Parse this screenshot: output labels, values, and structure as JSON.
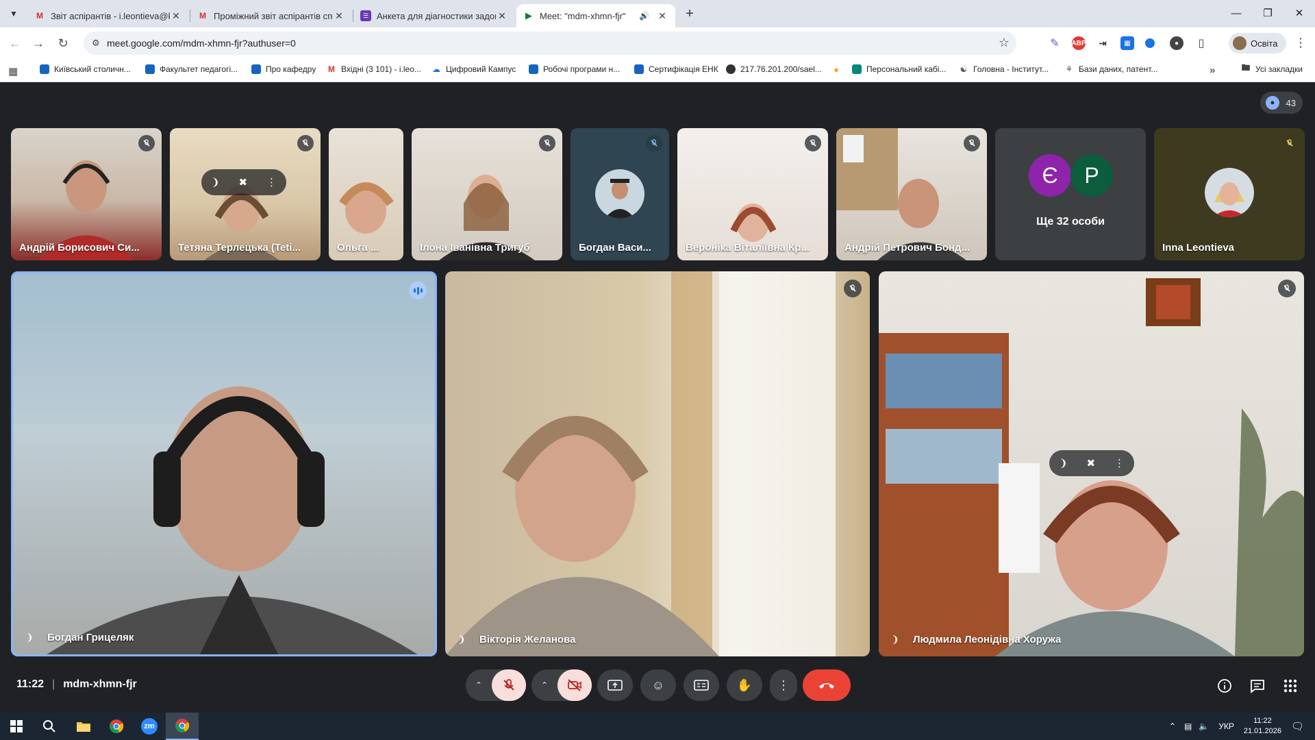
{
  "browser": {
    "tabs": [
      {
        "title": "Звіт аспірантів - i.leontieva@ku",
        "icon": "gmail-icon",
        "active": false,
        "audio": false
      },
      {
        "title": "Проміжний звіт аспірантів спе",
        "icon": "gmail-icon",
        "active": false,
        "audio": false
      },
      {
        "title": "Анкета для діагностики задово",
        "icon": "google-forms-icon",
        "active": false,
        "audio": false
      },
      {
        "title": "Meet: \"mdm-xhmn-fjr\"",
        "icon": "google-meet-icon",
        "active": true,
        "audio": true
      }
    ],
    "url": "meet.google.com/mdm-xhmn-fjr?authuser=0",
    "profile_name": "Освіта",
    "bookmarks": [
      "Київський столичн...",
      "Факультет педагогі...",
      "Про кафедру",
      "Вхідні (3 101) - i.leo...",
      "Цифровий Кампус",
      "Робочі програми н...",
      "Сертифікація ЕНК",
      "217.76.201.200/sael...",
      "",
      "Персональний кабі...",
      "Головна - Інститут...",
      "Бази даних, патент..."
    ],
    "all_bookmarks_label": "Усі закладки",
    "extensions_abp_label": "ABP"
  },
  "meet": {
    "participant_count": "43",
    "more_people_label": "Ще 32 особи",
    "more_people_initials": [
      "Є",
      "Р"
    ],
    "filmstrip": [
      {
        "name": "Андрій Борисович Си...",
        "muted": true
      },
      {
        "name": "Тетяна Терлецька (Teti...",
        "muted": true
      },
      {
        "name": "Ольга ...",
        "muted": false
      },
      {
        "name": "Ілона Іванівна Тригуб",
        "muted": true
      },
      {
        "name": "Богдан Васи...",
        "muted": true
      },
      {
        "name": "Вероніка Віталіївна Кр...",
        "muted": true
      },
      {
        "name": "Андрій Петрович Бонд...",
        "muted": true
      },
      {
        "name": "Inna Leontieva",
        "muted": true
      }
    ],
    "main": [
      {
        "name": "Богдан Грицеляк",
        "speaking": true
      },
      {
        "name": "Вікторія Желанова",
        "speaking": false
      },
      {
        "name": "Людмила Леонідівна Хоружа",
        "speaking": false
      }
    ],
    "time": "11:22",
    "meeting_code": "mdm-xhmn-fjr"
  },
  "taskbar": {
    "language": "УКР",
    "time": "11:22",
    "date": "21.01.2026",
    "zoom_label": "zm"
  },
  "colors": {
    "meet_bg": "#202124",
    "tile_bg": "#3c4043",
    "speaking_border": "#8ab4f8",
    "end_call": "#ea4335",
    "muted_button_bg": "#f9dedc",
    "avatar_e": "#8e24aa",
    "avatar_p": "#0b5d3b"
  }
}
